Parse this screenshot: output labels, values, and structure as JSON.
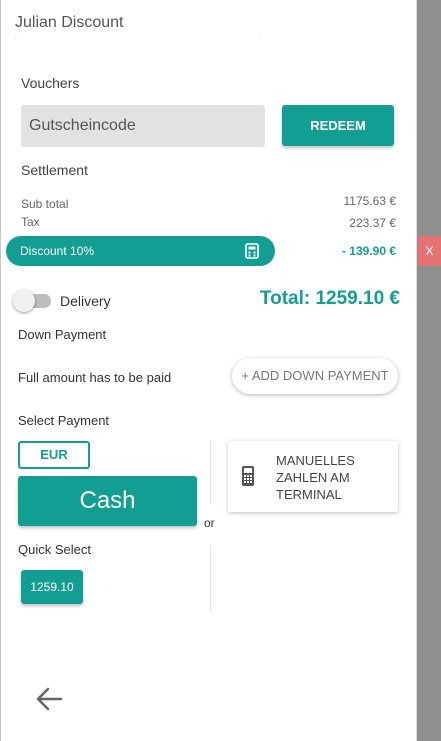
{
  "customer": {
    "name": "Julian Discount",
    "sub_line": ", ."
  },
  "vouchers": {
    "heading": "Vouchers",
    "input_placeholder": "Gutscheincode",
    "redeem_label": "REDEEM"
  },
  "settlement": {
    "heading": "Settlement",
    "subtotal_label": "Sub total",
    "subtotal_value": "1175.63 €",
    "tax_label": "Tax",
    "tax_value": "223.37 €",
    "discount_label": "Discount 10%",
    "discount_value": "- 139.90 €",
    "discount_remove": "X"
  },
  "delivery": {
    "label": "Delivery",
    "enabled": false
  },
  "total": "Total: 1259.10 €",
  "down_payment": {
    "heading": "Down Payment",
    "note": "Full amount has to be paid",
    "add_label": "+ ADD DOWN PAYMENT"
  },
  "payment": {
    "heading": "Select Payment",
    "currency": "EUR",
    "cash_label": "Cash",
    "or_label": "or",
    "terminal_label": "MANUELLES ZAHLEN AM TERMINAL",
    "quick_heading": "Quick Select",
    "quick_amounts": [
      "1259.10"
    ]
  },
  "icons": {
    "calculator": "calculator-icon",
    "terminal": "card-terminal-icon",
    "back": "arrow-left-icon"
  },
  "colors": {
    "accent": "#139e94",
    "danger": "#e57373",
    "overlay": "#8f8f8f"
  }
}
